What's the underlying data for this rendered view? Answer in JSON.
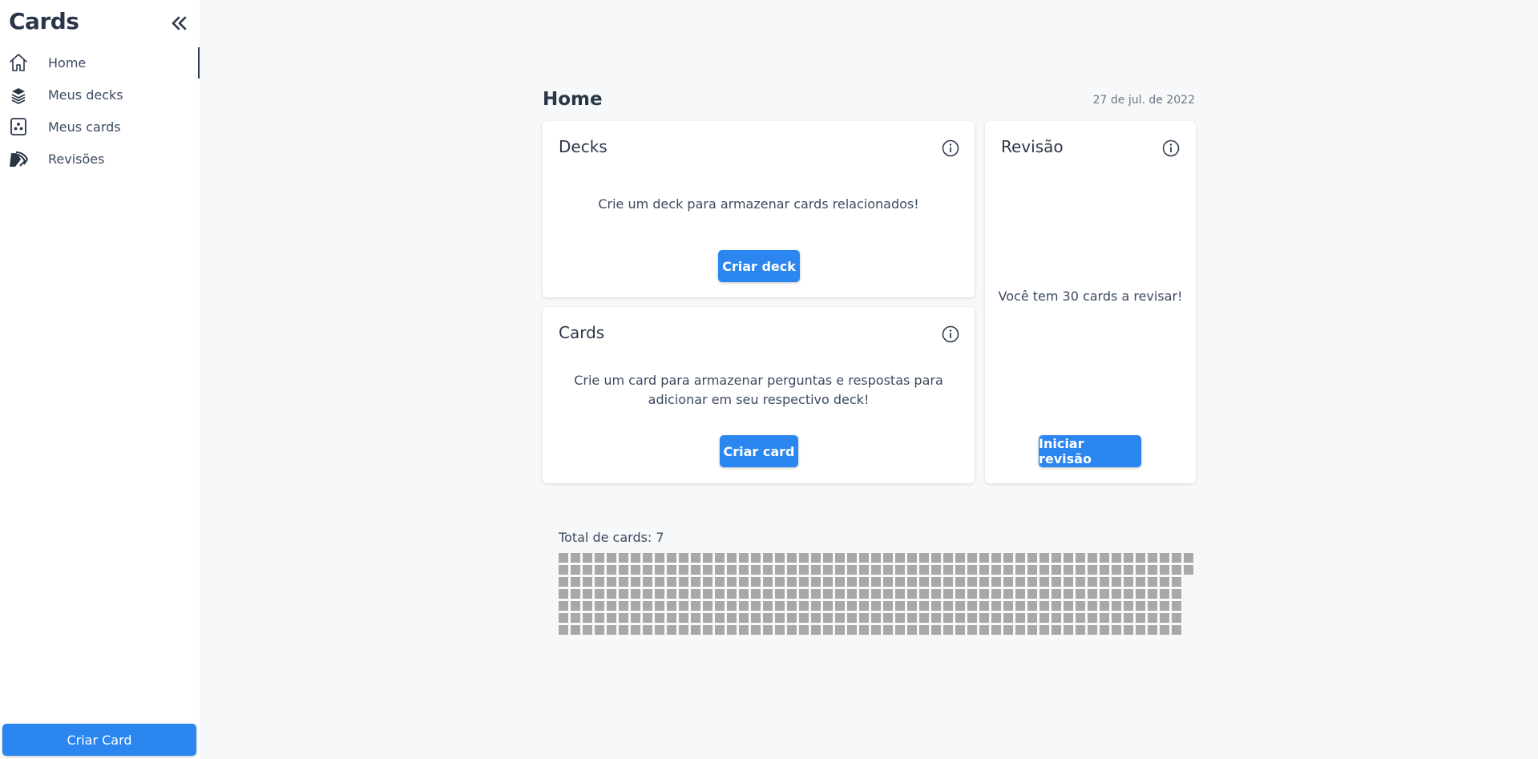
{
  "app": {
    "brand": "Cards"
  },
  "sidebar": {
    "items": [
      {
        "label": "Home",
        "icon": "home-icon",
        "active": true
      },
      {
        "label": "Meus decks",
        "icon": "decks-icon",
        "active": false
      },
      {
        "label": "Meus cards",
        "icon": "card-icon",
        "active": false
      },
      {
        "label": "Revisões",
        "icon": "review-icon",
        "active": false
      }
    ],
    "cta_label": "Criar Card"
  },
  "main": {
    "title": "Home",
    "date": "27 de jul. de 2022",
    "decks": {
      "title": "Decks",
      "text": "Crie um deck para armazenar cards relacionados!",
      "button": "Criar deck"
    },
    "cards": {
      "title": "Cards",
      "text": "Crie um card para armazenar perguntas e respostas para adicionar em seu respectivo deck!",
      "button": "Criar card"
    },
    "review": {
      "title": "Revisão",
      "text": "Você tem 30 cards a revisar!",
      "button": "Iniciar revisão"
    },
    "total_label": "Total de cards: 7"
  },
  "colors": {
    "accent": "#2b86f0",
    "text": "#2a3547",
    "background": "#f7f8fa",
    "heatmap_cell": "#a8a8a8"
  }
}
